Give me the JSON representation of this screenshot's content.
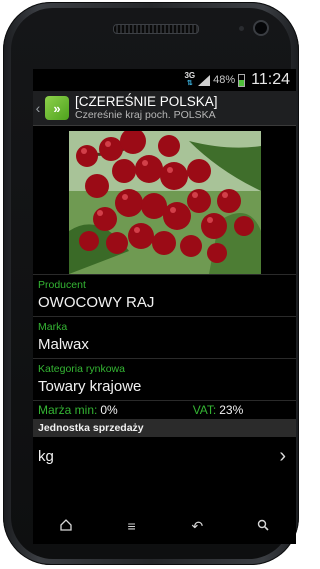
{
  "status": {
    "network": "3G",
    "battery": "48%",
    "time": "11:24"
  },
  "actionbar": {
    "back_icon": "chevron-left",
    "app_icon": "double-chevron-logo",
    "title": "[CZEREŚNIE POLSKA]",
    "subtitle": "Czereśnie kraj poch. POLSKA"
  },
  "product_image": {
    "alt": "cherries"
  },
  "fields": {
    "producer": {
      "label": "Producent",
      "value": "OWOCOWY RAJ"
    },
    "brand": {
      "label": "Marka",
      "value": "Malwax"
    },
    "market_category": {
      "label": "Kategoria rynkowa",
      "value": "Towary krajowe"
    }
  },
  "margin": {
    "label": "Marża min:",
    "value": "0%"
  },
  "vat": {
    "label": "VAT:",
    "value": "23%"
  },
  "sales_unit": {
    "section_label": "Jednostka sprzedaży",
    "value": "kg"
  },
  "navbar": {
    "home_icon": "home-icon",
    "menu_icon": "menu-icon",
    "back_icon": "back-arrow-icon",
    "search_icon": "search-icon"
  },
  "colors": {
    "accent": "#34b533",
    "background": "#000000"
  }
}
